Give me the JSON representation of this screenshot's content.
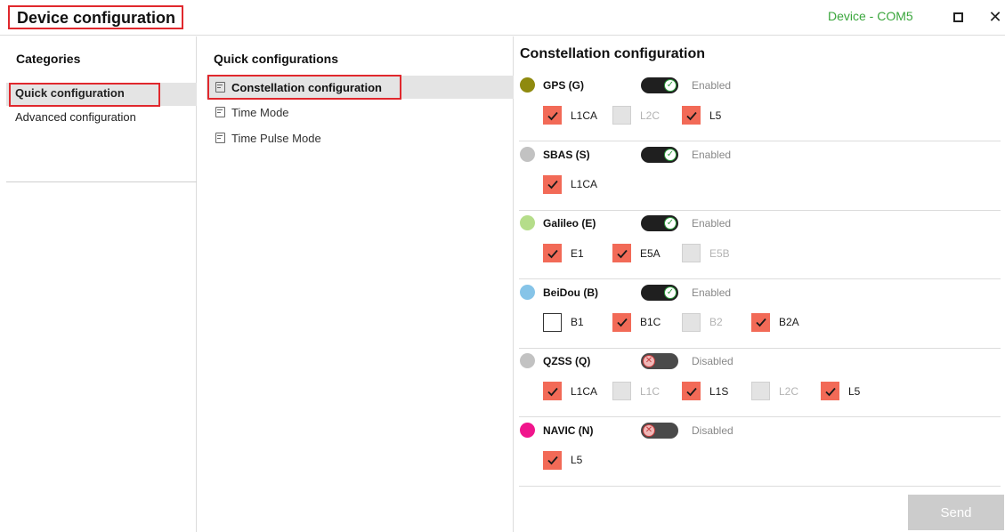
{
  "window": {
    "title": "Device configuration",
    "device": "Device - COM5",
    "maximize_glyph": "",
    "close_glyph": "✕"
  },
  "categories": {
    "heading": "Categories",
    "items": [
      {
        "label": "Quick configuration",
        "active": true
      },
      {
        "label": "Advanced configuration",
        "active": false
      }
    ]
  },
  "quick": {
    "heading": "Quick configurations",
    "items": [
      {
        "label": "Constellation configuration",
        "active": true
      },
      {
        "label": "Time Mode",
        "active": false
      },
      {
        "label": "Time Pulse Mode",
        "active": false
      }
    ]
  },
  "main": {
    "title": "Constellation configuration",
    "constellations": [
      {
        "name": "GPS (G)",
        "color": "#8f8a0f",
        "state": "Enabled",
        "signals": [
          {
            "label": "L1CA",
            "status": "checked"
          },
          {
            "label": "L2C",
            "status": "disabled"
          },
          {
            "label": "L5",
            "status": "checked"
          }
        ]
      },
      {
        "name": "SBAS (S)",
        "color": "#c2c2c2",
        "state": "Enabled",
        "signals": [
          {
            "label": "L1CA",
            "status": "checked"
          }
        ]
      },
      {
        "name": "Galileo (E)",
        "color": "#b5dd8a",
        "state": "Enabled",
        "signals": [
          {
            "label": "E1",
            "status": "checked"
          },
          {
            "label": "E5A",
            "status": "checked"
          },
          {
            "label": "E5B",
            "status": "disabled"
          }
        ]
      },
      {
        "name": "BeiDou (B)",
        "color": "#86c4e8",
        "state": "Enabled",
        "signals": [
          {
            "label": "B1",
            "status": "unchecked"
          },
          {
            "label": "B1C",
            "status": "checked"
          },
          {
            "label": "B2",
            "status": "disabled"
          },
          {
            "label": "B2A",
            "status": "checked"
          }
        ]
      },
      {
        "name": "QZSS (Q)",
        "color": "#c2c2c2",
        "state": "Disabled",
        "signals": [
          {
            "label": "L1CA",
            "status": "checked"
          },
          {
            "label": "L1C",
            "status": "disabled"
          },
          {
            "label": "L1S",
            "status": "checked"
          },
          {
            "label": "L2C",
            "status": "disabled"
          },
          {
            "label": "L5",
            "status": "checked"
          }
        ]
      },
      {
        "name": "NAVIC (N)",
        "color": "#f0158c",
        "state": "Disabled",
        "signals": [
          {
            "label": "L5",
            "status": "checked"
          }
        ]
      }
    ],
    "send_label": "Send"
  },
  "colors": {
    "accent_red": "#e0282d",
    "checkbox_checked": "#f26a57",
    "toggle_on_check": "#2b9a3a",
    "device_green": "#3aa63c"
  }
}
